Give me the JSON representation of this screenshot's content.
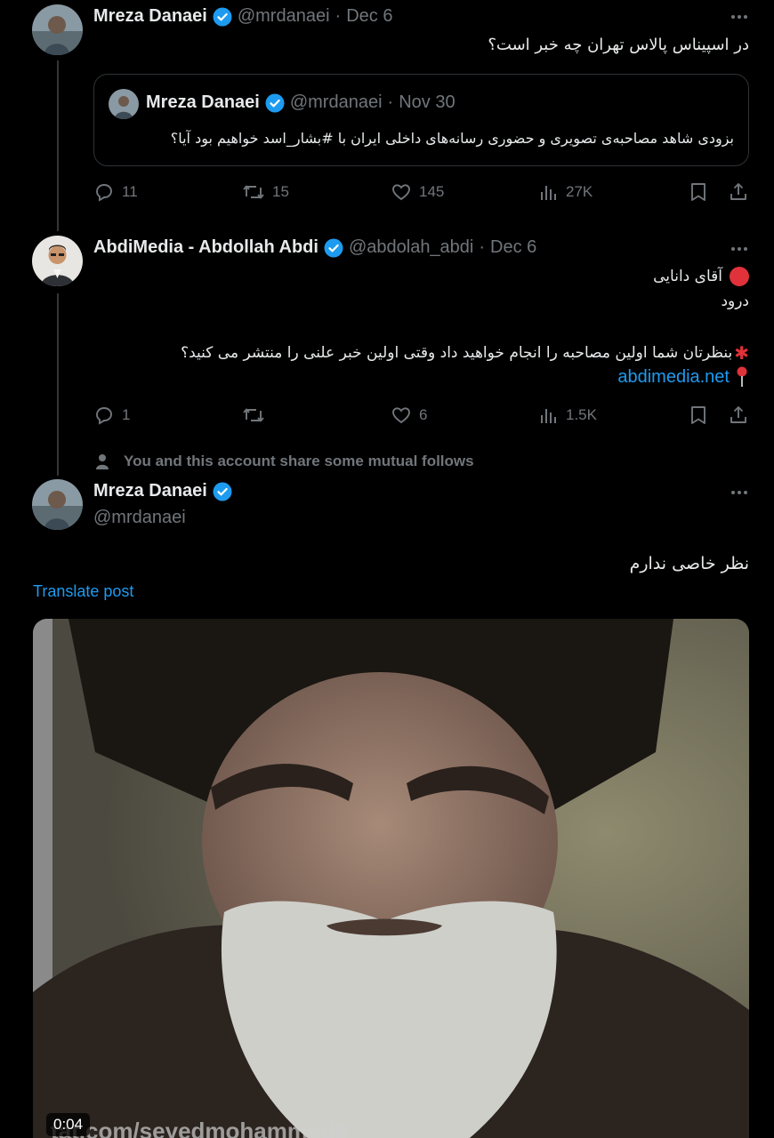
{
  "colors": {
    "accent": "#1d9bf0",
    "muted": "#71767b",
    "text": "#e7e9ea",
    "background": "#000000",
    "border": "#2f3336"
  },
  "post1": {
    "name": "Mreza Danaei",
    "handle": "@mrdanaei",
    "separator": "·",
    "date": "Dec 6",
    "text": "در اسپیناس پالاس تهران چه خبر است؟",
    "quote": {
      "name": "Mreza Danaei",
      "handle": "@mrdanaei",
      "separator": "·",
      "date": "Nov 30",
      "text": "بزودی شاهد مصاحبه‌ی تصویری و حضوری رسانه‌های داخلی ایران با #بشار_اسد خواهیم بود آیا؟"
    },
    "actions": {
      "replies": "11",
      "reposts": "15",
      "likes": "145",
      "views": "27K"
    }
  },
  "post2": {
    "name": "AbdiMedia - Abdollah Abdi",
    "handle": "@abdolah_abdi",
    "separator": "·",
    "date": "Dec 6",
    "line1": "آقای دانایی",
    "line2": "درود",
    "line3": "بنظرتان شما اولین مصاحبه را انجام خواهید داد وقتی اولین خبر علنی را منتشر می کنید؟",
    "link": "abdimedia.net",
    "actions": {
      "replies": "1",
      "reposts": "",
      "likes": "6",
      "views": "1.5K"
    }
  },
  "mutual": {
    "text": "You and this account share some mutual follows"
  },
  "post3": {
    "name": "Mreza Danaei",
    "handle": "@mrdanaei",
    "text": "نظر خاصی ندارم",
    "translate": "Translate post",
    "video_time": "0:04"
  },
  "icons": {
    "verified": "verified-badge-icon",
    "reply": "reply-icon",
    "repost": "repost-icon",
    "like": "heart-icon",
    "views": "views-icon",
    "bookmark": "bookmark-icon",
    "share": "share-icon",
    "more": "more-dots-icon",
    "person": "person-icon"
  }
}
